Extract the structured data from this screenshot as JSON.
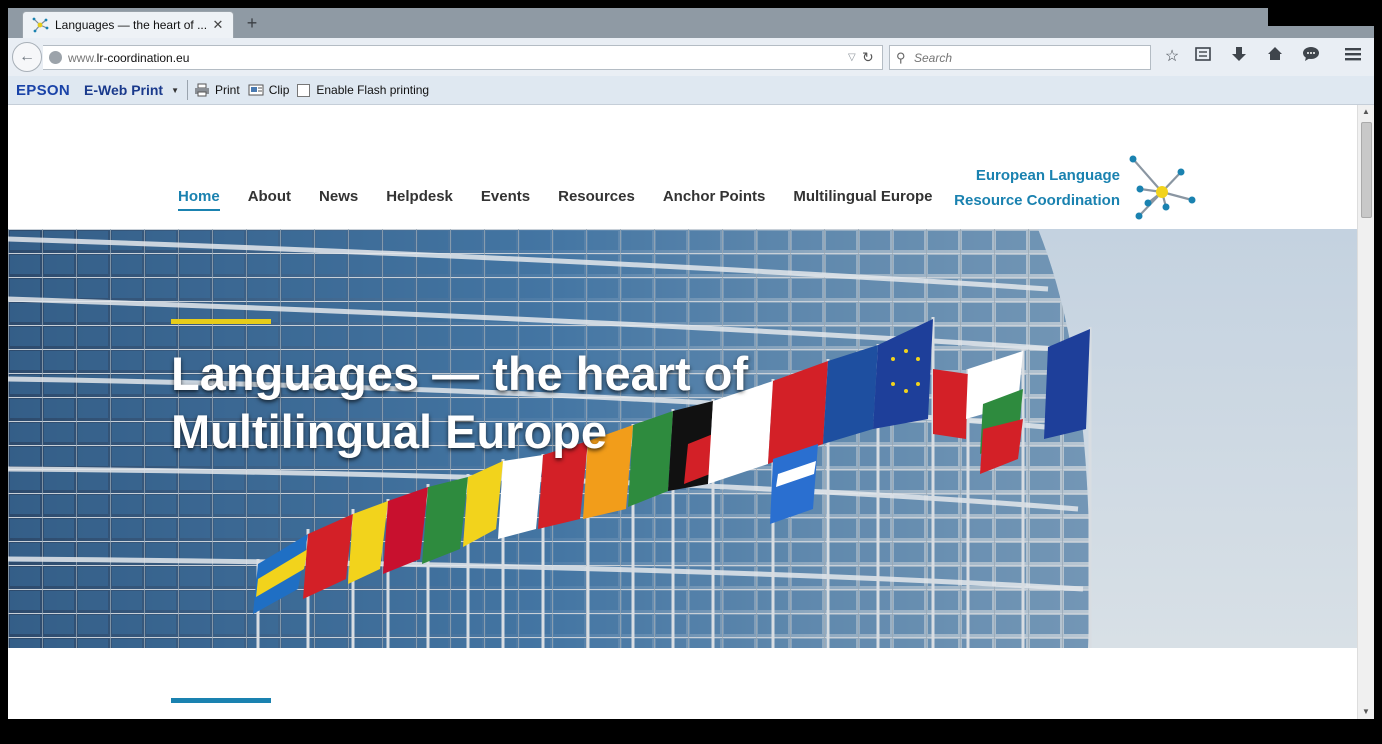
{
  "browser": {
    "tab": {
      "title": "Languages — the heart of ...",
      "close": "✕"
    },
    "new_tab": "+",
    "back": "←",
    "url": {
      "prefix": "www.",
      "host": "lr-coordination.eu"
    },
    "search": {
      "placeholder": "Search"
    },
    "icons": [
      "star-icon",
      "reading-list-icon",
      "download-icon",
      "home-icon",
      "chat-icon",
      "menu-icon"
    ]
  },
  "epson_toolbar": {
    "logo": "EPSON",
    "product": "E-Web Print",
    "print_label": "Print",
    "clip_label": "Clip",
    "flash_label": "Enable Flash printing"
  },
  "site": {
    "menu": [
      {
        "label": "Home",
        "active": true
      },
      {
        "label": "About"
      },
      {
        "label": "News"
      },
      {
        "label": "Helpdesk"
      },
      {
        "label": "Events"
      },
      {
        "label": "Resources"
      },
      {
        "label": "Anchor Points"
      },
      {
        "label": "Multilingual Europe"
      }
    ],
    "brand": {
      "line1": "European Language",
      "line2": "Resource Coordination"
    },
    "hero": {
      "title_line1": "Languages — the heart of",
      "title_line2": "Multilingual Europe"
    }
  },
  "colors": {
    "accent_blue": "#1a82b0",
    "accent_yellow": "#e6cc1a"
  }
}
